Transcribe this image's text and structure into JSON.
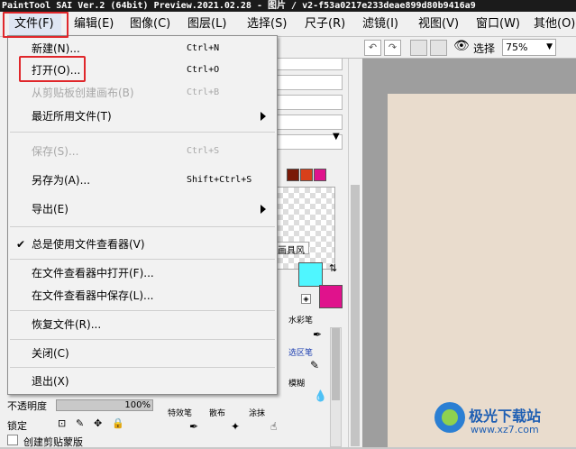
{
  "window": {
    "title": "PaintTool SAI Ver.2 (64bit) Preview.2021.02.28 - 图片 / v2-f53a0217e233deae899d80b9416a9"
  },
  "menubar": {
    "items": [
      {
        "label": "文件(F)"
      },
      {
        "label": "编辑(E)"
      },
      {
        "label": "图像(C)"
      },
      {
        "label": "图层(L)"
      },
      {
        "label": "选择(S)"
      },
      {
        "label": "尺子(R)"
      },
      {
        "label": "滤镜(I)"
      },
      {
        "label": "视图(V)"
      },
      {
        "label": "窗口(W)"
      },
      {
        "label": "其他(O)"
      }
    ]
  },
  "file_menu": {
    "items": [
      {
        "label": "新建(N)...",
        "shortcut": "Ctrl+N"
      },
      {
        "label": "打开(O)...",
        "shortcut": "Ctrl+O"
      },
      {
        "label": "从剪贴板创建画布(B)",
        "shortcut": "Ctrl+B"
      },
      {
        "label": "最近所用文件(T)",
        "shortcut": ""
      },
      {
        "label": "保存(S)...",
        "shortcut": "Ctrl+S"
      },
      {
        "label": "另存为(A)...",
        "shortcut": "Shift+Ctrl+S"
      },
      {
        "label": "导出(E)",
        "shortcut": ""
      },
      {
        "label": "总是使用文件查看器(V)",
        "shortcut": ""
      },
      {
        "label": "在文件查看器中打开(F)...",
        "shortcut": ""
      },
      {
        "label": "在文件查看器中保存(L)...",
        "shortcut": ""
      },
      {
        "label": "恢复文件(R)...",
        "shortcut": ""
      },
      {
        "label": "关闭(C)",
        "shortcut": ""
      },
      {
        "label": "退出(X)",
        "shortcut": ""
      }
    ]
  },
  "toolbar": {
    "select_label": "选择",
    "zoom": "75%"
  },
  "tools": {
    "brush_tab": "画具风",
    "watercolor": "水彩笔",
    "select_brush": "选区笔",
    "blur": "模糊",
    "special": "特效笔",
    "scatter": "散布",
    "smudge": "涂抹"
  },
  "layer_panel": {
    "opacity_label": "不透明度",
    "opacity_value": "100%",
    "lock_label": "锁定",
    "clip_label": "创建剪贴蒙版"
  },
  "colors": {
    "accent_red": "#e0272b",
    "canvas": "#e9dccd",
    "magenta": "#e0128c",
    "cyan": "#4ff6ff"
  },
  "watermark": {
    "text": "极光下载站",
    "url": "www.xz7.com"
  }
}
